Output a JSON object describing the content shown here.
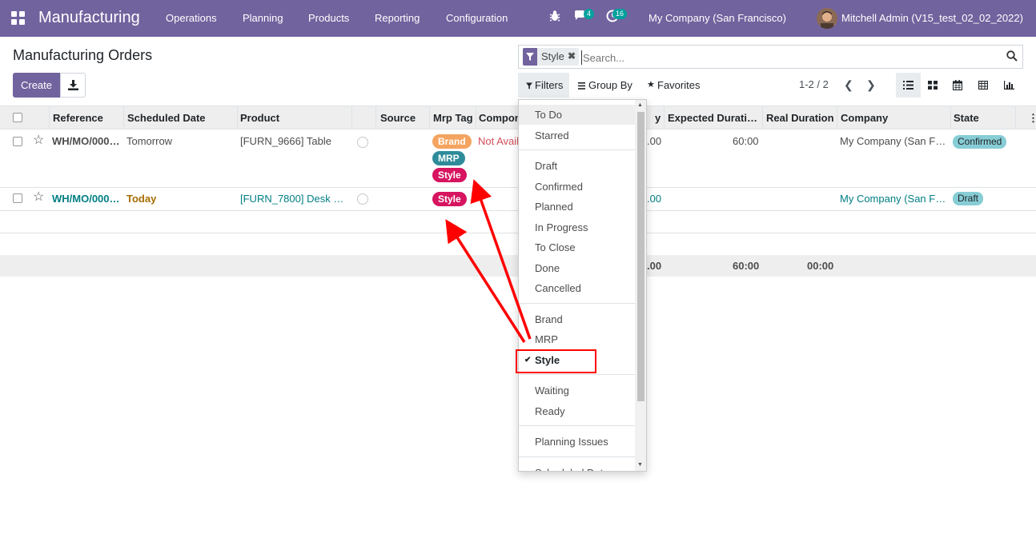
{
  "navbar": {
    "app_name": "Manufacturing",
    "menus": [
      "Operations",
      "Planning",
      "Products",
      "Reporting",
      "Configuration"
    ],
    "messages_count": "4",
    "activities_count": "16",
    "company": "My Company (San Francisco)",
    "user": "Mitchell Admin (V15_test_02_02_2022)",
    "color": "#71639e"
  },
  "page": {
    "title": "Manufacturing Orders",
    "create_label": "Create"
  },
  "search": {
    "facet_label": "Style",
    "placeholder": "Search..."
  },
  "filters": {
    "filters_label": "Filters",
    "group_by_label": "Group By",
    "favorites_label": "Favorites"
  },
  "pager": {
    "text": "1-2 / 2"
  },
  "table": {
    "headers": [
      "Reference",
      "Scheduled Date",
      "Product",
      "Source",
      "Mrp Tag",
      "Compon",
      "y",
      "Expected Durati…",
      "Real Duration",
      "Company",
      "State"
    ],
    "rows": [
      {
        "reference": "WH/MO/000…",
        "scheduled_date": "Tomorrow",
        "product": "[FURN_9666] Table",
        "tags": [
          "Brand",
          "MRP",
          "Style"
        ],
        "component": "Not Avail",
        "qty": ".00",
        "expected_duration": "60:00",
        "company": "My Company (San F…",
        "state": "Confirmed"
      },
      {
        "reference": "WH/MO/000…",
        "scheduled_date": "Today",
        "product": "[FURN_7800] Desk …",
        "tags": [
          "Style"
        ],
        "qty": ".00",
        "company": "My Company (San F…",
        "state": "Draft"
      }
    ],
    "totals": {
      "qty": ".00",
      "expected": "60:00",
      "real": "00:00"
    }
  },
  "tag_colors": {
    "Brand": "#f4a460",
    "MRP": "#2e8b9a",
    "Style": "#d6145f"
  },
  "dropdown": {
    "groups": [
      [
        "To Do",
        "Starred"
      ],
      [
        "Draft",
        "Confirmed",
        "Planned",
        "In Progress",
        "To Close",
        "Done",
        "Cancelled"
      ],
      [
        "Brand",
        "MRP",
        "Style"
      ],
      [
        "Waiting",
        "Ready"
      ],
      [
        "Planning Issues"
      ],
      [
        "Scheduled Date"
      ]
    ]
  },
  "annotation_color": "#ff0000"
}
